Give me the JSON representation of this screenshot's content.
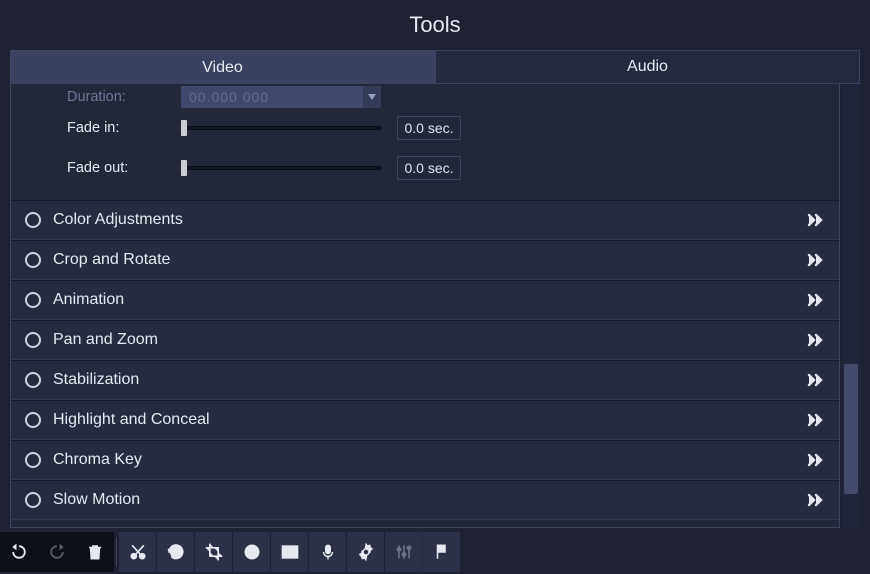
{
  "title": "Tools",
  "tabs": {
    "video": "Video",
    "audio": "Audio",
    "active": "video"
  },
  "settings": {
    "duration": {
      "label": "Duration:",
      "value": "00.000 000"
    },
    "fade_in": {
      "label": "Fade in:",
      "value": "0.0 sec."
    },
    "fade_out": {
      "label": "Fade out:",
      "value": "0.0 sec."
    }
  },
  "accordion": [
    {
      "label": "Color Adjustments"
    },
    {
      "label": "Crop and Rotate"
    },
    {
      "label": "Animation"
    },
    {
      "label": "Pan and Zoom"
    },
    {
      "label": "Stabilization"
    },
    {
      "label": "Highlight and Conceal"
    },
    {
      "label": "Chroma Key"
    },
    {
      "label": "Slow Motion"
    }
  ],
  "toolbar": {
    "undo": "undo",
    "redo": "redo",
    "delete": "delete",
    "cut": "cut",
    "rotate": "rotate",
    "crop": "crop",
    "color": "color",
    "aspect": "aspect",
    "mic": "mic",
    "gear": "settings",
    "equalizer": "equalizer",
    "marker": "marker"
  }
}
